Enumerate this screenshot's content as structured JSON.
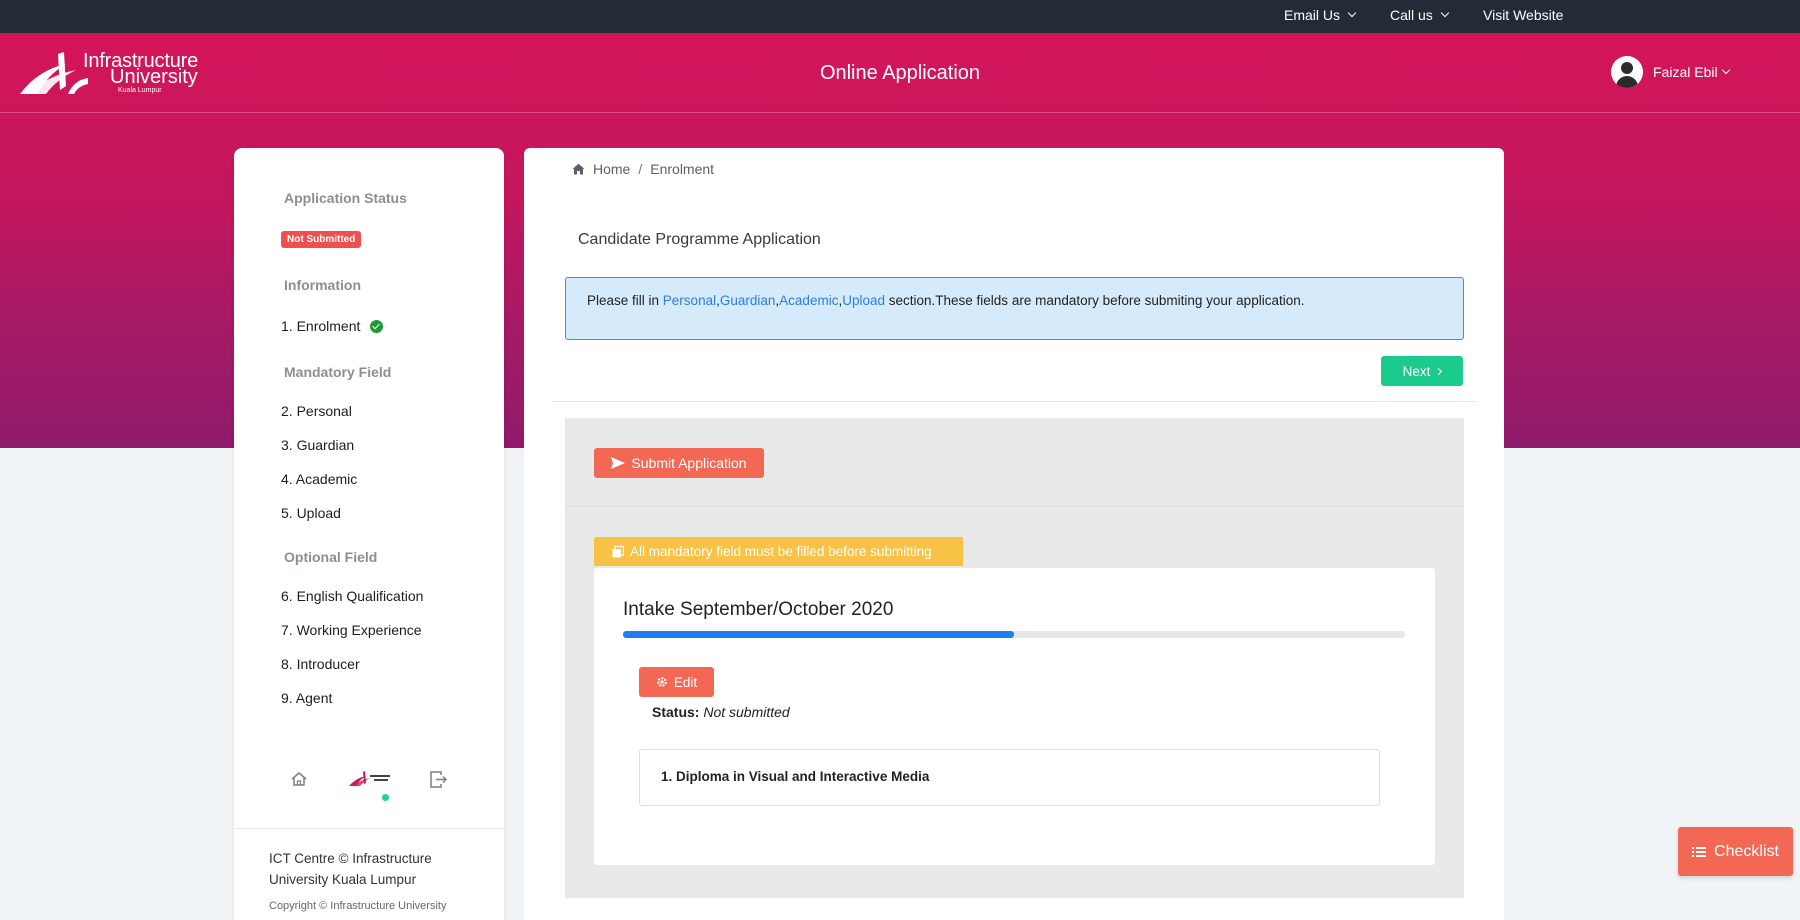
{
  "topbar": {
    "email_label": "Email Us",
    "call_label": "Call us",
    "website_label": "Visit Website"
  },
  "header": {
    "logo": {
      "line1": "Infrastructure",
      "line2": "University",
      "line3": "Kuala Lumpur"
    },
    "title": "Online Application",
    "user_name": "Faizal Ebil"
  },
  "sidebar": {
    "status_heading": "Application Status",
    "status_badge": "Not Submitted",
    "info_heading": "Information",
    "info_items": [
      {
        "label": "1. Enrolment",
        "complete": true
      }
    ],
    "mandatory_heading": "Mandatory Field",
    "mandatory_items": [
      "2. Personal",
      "3. Guardian",
      "4. Academic",
      "5. Upload"
    ],
    "optional_heading": "Optional Field",
    "optional_items": [
      "6. English Qualification",
      "7. Working Experience",
      "8. Introducer",
      "9. Agent"
    ],
    "footer_text": "ICT Centre © Infrastructure University Kuala Lumpur",
    "copyright": "Copyright © Infrastructure University"
  },
  "breadcrumb": {
    "home": "Home",
    "separator": "/",
    "current": "Enrolment"
  },
  "main": {
    "heading": "Candidate Programme Application",
    "alert": {
      "prefix": "Please fill in ",
      "links": [
        "Personal",
        "Guardian",
        "Academic",
        "Upload"
      ],
      "comma": ",",
      "suffix": " section.These fields are mandatory before submiting your application."
    },
    "next_label": "Next",
    "submit_label": "Submit Application",
    "warning": "All mandatory field must be filled before submitting",
    "intake_title": "Intake September/October 2020",
    "progress": 0.5,
    "edit_label": "Edit",
    "status_label": "Status:",
    "status_value": "Not submitted",
    "programme": "1. Diploma in Visual and Interactive Media"
  },
  "checklist_label": "Checklist",
  "colors": {
    "hero_top": "#d41558",
    "hero_bottom": "#8f1a6c",
    "topbar": "#222b36",
    "next": "#1bcb8b",
    "danger": "#f26855",
    "warning": "#f8c246",
    "progress": "#1f7ff0",
    "link": "#2a7de4"
  },
  "icons": [
    "chevron-down-icon",
    "avatar-icon",
    "check-circle-icon",
    "home-icon",
    "logout-icon",
    "paper-plane-icon",
    "copy-icon",
    "gear-icon",
    "list-icon",
    "chevron-right-icon"
  ]
}
